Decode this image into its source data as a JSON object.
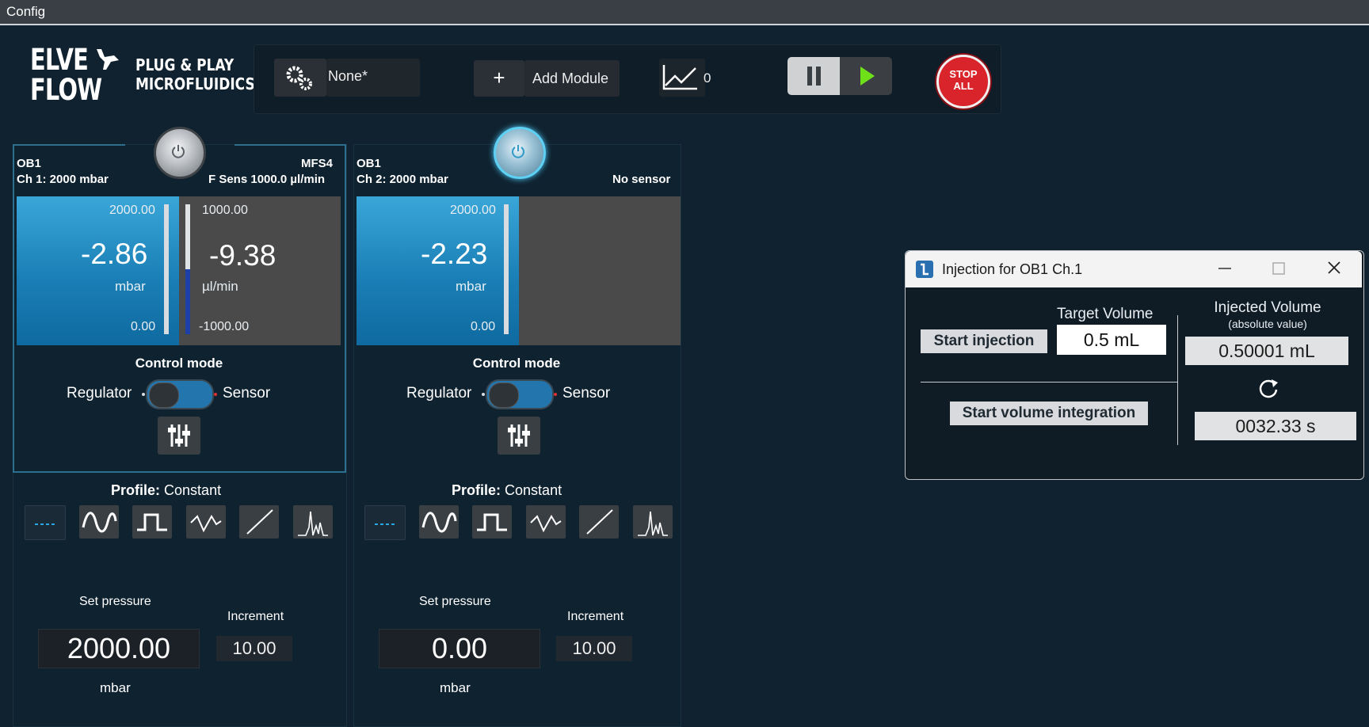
{
  "menubar": {
    "title": "Config"
  },
  "logo": {
    "line1": "ELVE",
    "line2": "FLOW",
    "tagline1": "PLUG & PLAY",
    "tagline2": "MICROFLUIDICS"
  },
  "toolbar": {
    "config_value": "None*",
    "add_module": "Add Module",
    "plus": "+",
    "graph_count": "0",
    "stop_line1": "STOP",
    "stop_line2": "ALL"
  },
  "channels": [
    {
      "device": "OB1",
      "channel": "Ch 1: 2000 mbar",
      "sensor_name": "MFS4",
      "sensor_desc": "F Sens 1000.0 µl/min",
      "pressure": {
        "max": "2000.00",
        "value": "-2.86",
        "unit": "mbar",
        "min": "0.00",
        "fill_fraction": 0.0
      },
      "flow": {
        "max": "1000.00",
        "value": "-9.38",
        "unit": "µl/min",
        "min": "-1000.00",
        "fill_fraction": 0.5
      },
      "control_mode": "Control mode",
      "regulator": "Regulator",
      "sensor": "Sensor",
      "profile_label": "Profile:",
      "profile_value": "Constant",
      "set_pressure_label": "Set pressure",
      "set_pressure": "2000.00",
      "set_unit": "mbar",
      "increment_label": "Increment",
      "increment": "10.00",
      "power_on": false
    },
    {
      "device": "OB1",
      "channel": "Ch 2: 2000 mbar",
      "sensor_desc": "No sensor",
      "pressure": {
        "max": "2000.00",
        "value": "-2.23",
        "unit": "mbar",
        "min": "0.00",
        "fill_fraction": 0.0
      },
      "control_mode": "Control mode",
      "regulator": "Regulator",
      "sensor": "Sensor",
      "profile_label": "Profile:",
      "profile_value": "Constant",
      "set_pressure_label": "Set pressure",
      "set_pressure": "0.00",
      "set_unit": "mbar",
      "increment_label": "Increment",
      "increment": "10.00",
      "power_on": true
    }
  ],
  "dialog": {
    "title": "Injection for OB1 Ch.1",
    "start_injection": "Start injection",
    "target_volume_label": "Target Volume",
    "target_volume": "0.5 mL",
    "injected_label": "Injected Volume",
    "injected_sub": "(absolute value)",
    "injected_value": "0.50001 mL",
    "start_integration": "Start volume integration",
    "timer": "0032.33 s"
  },
  "colors": {
    "background": "#10222f",
    "accent_blue": "#1a86c0",
    "stop_red": "#d8242a"
  }
}
